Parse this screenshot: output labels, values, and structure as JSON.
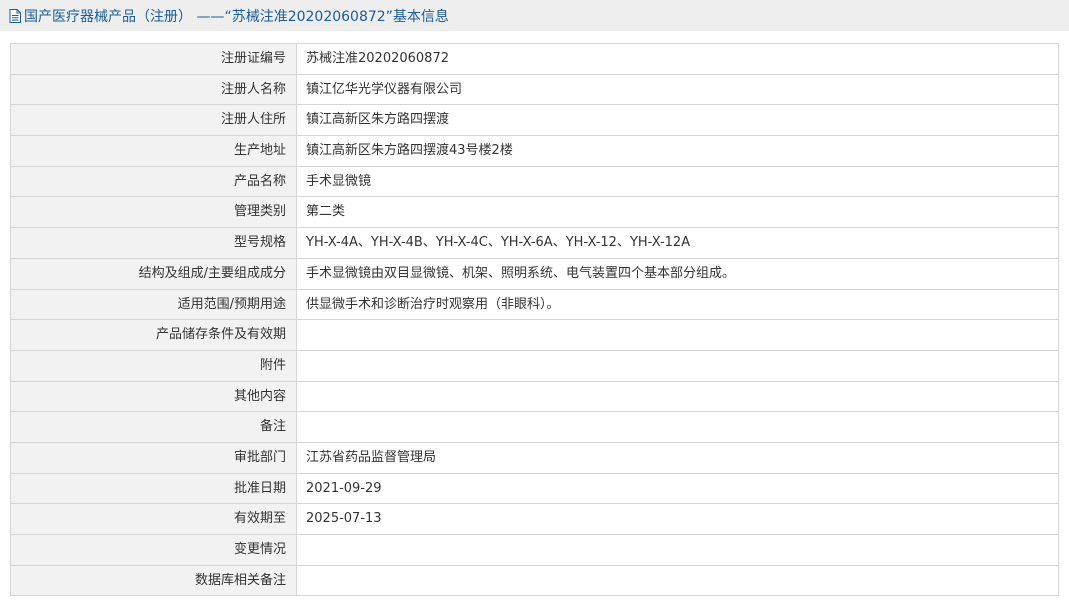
{
  "header": {
    "icon": "document-icon",
    "title": "国产医疗器械产品（注册） ——“苏械注准20202060872”基本信息",
    "color": "#1c5c99"
  },
  "rows": [
    {
      "label": "注册证编号",
      "value": "苏械注准20202060872"
    },
    {
      "label": "注册人名称",
      "value": "镇江亿华光学仪器有限公司"
    },
    {
      "label": "注册人住所",
      "value": "镇江高新区朱方路四摆渡"
    },
    {
      "label": "生产地址",
      "value": "镇江高新区朱方路四摆渡43号楼2楼"
    },
    {
      "label": "产品名称",
      "value": "手术显微镜"
    },
    {
      "label": "管理类别",
      "value": "第二类"
    },
    {
      "label": "型号规格",
      "value": "YH-X-4A、YH-X-4B、YH-X-4C、YH-X-6A、YH-X-12、YH-X-12A"
    },
    {
      "label": "结构及组成/主要组成成分",
      "value": "手术显微镜由双目显微镜、机架、照明系统、电气装置四个基本部分组成。"
    },
    {
      "label": "适用范围/预期用途",
      "value": "供显微手术和诊断治疗时观察用（非眼科）。"
    },
    {
      "label": "产品储存条件及有效期",
      "value": ""
    },
    {
      "label": "附件",
      "value": ""
    },
    {
      "label": "其他内容",
      "value": ""
    },
    {
      "label": "备注",
      "value": ""
    },
    {
      "label": "审批部门",
      "value": "江苏省药品监督管理局"
    },
    {
      "label": "批准日期",
      "value": "2021-09-29"
    },
    {
      "label": "有效期至",
      "value": "2025-07-13"
    },
    {
      "label": "变更情况",
      "value": ""
    },
    {
      "label": "数据库相关备注",
      "value": ""
    }
  ]
}
